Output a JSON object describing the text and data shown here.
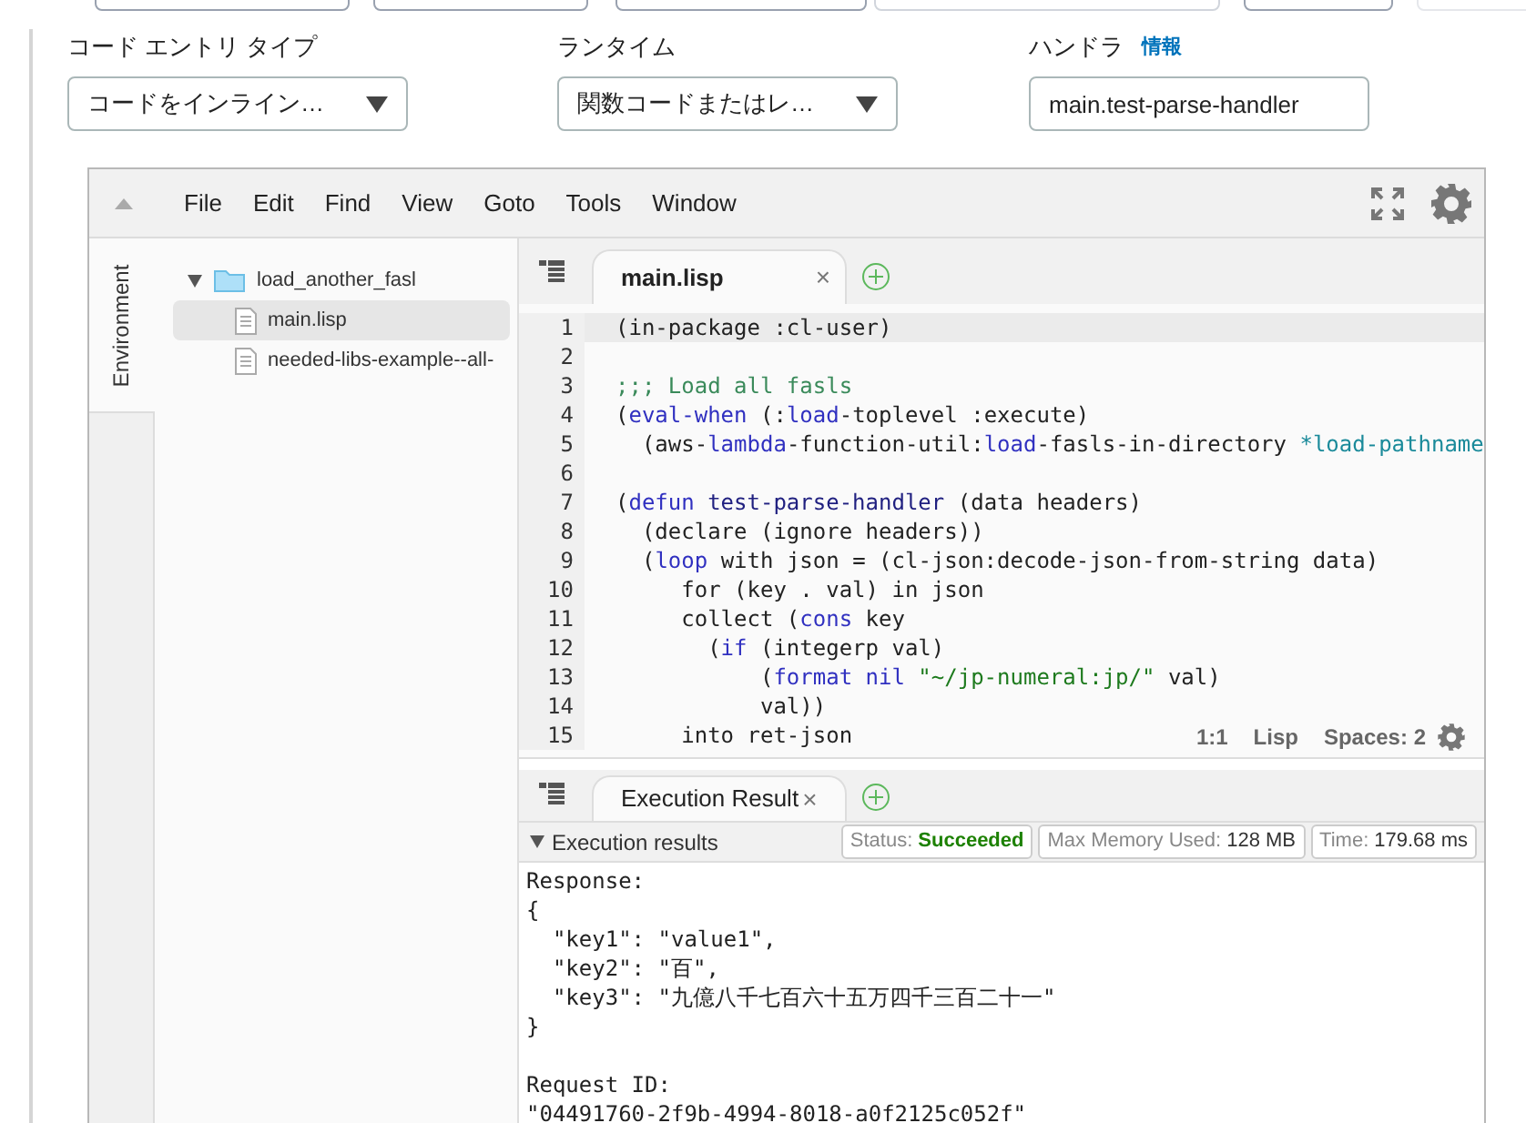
{
  "config": {
    "fields": [
      {
        "label": "コード エントリ タイプ",
        "kind": "select",
        "value": "コードをインライン…"
      },
      {
        "label": "ランタイム",
        "kind": "select",
        "value": "関数コードまたはレ…"
      },
      {
        "label": "ハンドラ",
        "info": "情報",
        "kind": "text",
        "value": "main.test-parse-handler"
      }
    ]
  },
  "ide": {
    "menu": [
      "File",
      "Edit",
      "Find",
      "View",
      "Goto",
      "Tools",
      "Window"
    ],
    "side_tab": "Environment",
    "tree": [
      {
        "label": "load_another_fasl",
        "kind": "folder",
        "expanded": true,
        "selected": false,
        "children": [
          {
            "label": "main.lisp",
            "kind": "file",
            "selected": true
          },
          {
            "label": "needed-libs-example--all-",
            "kind": "file",
            "selected": false
          }
        ]
      }
    ],
    "editor_tab": {
      "label": "main.lisp",
      "close": "×"
    },
    "code": [
      {
        "n": "1",
        "active": true,
        "seg": [
          {
            "kind": "plain",
            "text": "(in-package :cl-user)"
          }
        ]
      },
      {
        "n": "2",
        "active": false
      },
      {
        "n": "3",
        "active": false,
        "seg": [
          {
            "kind": "comment",
            "text": ";;; Load all fasls"
          }
        ]
      },
      {
        "n": "4",
        "active": false,
        "seg": [
          {
            "kind": "plain",
            "text": "("
          },
          {
            "kind": "keyword",
            "text": "eval-when"
          },
          {
            "kind": "plain",
            "text": " (:"
          },
          {
            "kind": "keyword",
            "text": "load"
          },
          {
            "kind": "plain",
            "text": "-toplevel :execute)"
          }
        ]
      },
      {
        "n": "5",
        "active": false,
        "seg": [
          {
            "kind": "plain",
            "text": "  (aws-"
          },
          {
            "kind": "keyword",
            "text": "lambda"
          },
          {
            "kind": "plain",
            "text": "-function-util:"
          },
          {
            "kind": "keyword",
            "text": "load"
          },
          {
            "kind": "plain",
            "text": "-fasls-in-directory "
          },
          {
            "kind": "variable",
            "text": "*load-pathname"
          }
        ]
      },
      {
        "n": "6",
        "active": false
      },
      {
        "n": "7",
        "active": false,
        "seg": [
          {
            "kind": "plain",
            "text": "("
          },
          {
            "kind": "keyword",
            "text": "defun"
          },
          {
            "kind": "definition",
            "text": " test-parse-handler"
          },
          {
            "kind": "plain",
            "text": " (data headers)"
          }
        ]
      },
      {
        "n": "8",
        "active": false,
        "seg": [
          {
            "kind": "plain",
            "text": "  (declare (ignore headers))"
          }
        ]
      },
      {
        "n": "9",
        "active": false,
        "seg": [
          {
            "kind": "plain",
            "text": "  ("
          },
          {
            "kind": "keyword",
            "text": "loop"
          },
          {
            "kind": "plain",
            "text": " with json = (cl-json:decode-json-from-string data)"
          }
        ]
      },
      {
        "n": "10",
        "active": false,
        "seg": [
          {
            "kind": "plain",
            "text": "     for (key . val) in json"
          }
        ]
      },
      {
        "n": "11",
        "active": false,
        "seg": [
          {
            "kind": "plain",
            "text": "     collect ("
          },
          {
            "kind": "keyword",
            "text": "cons"
          },
          {
            "kind": "plain",
            "text": " key"
          }
        ]
      },
      {
        "n": "12",
        "active": false,
        "seg": [
          {
            "kind": "plain",
            "text": "       ("
          },
          {
            "kind": "keyword",
            "text": "if"
          },
          {
            "kind": "plain",
            "text": " (integerp val)"
          }
        ]
      },
      {
        "n": "13",
        "active": false,
        "seg": [
          {
            "kind": "plain",
            "text": "           ("
          },
          {
            "kind": "keyword",
            "text": "format nil"
          },
          {
            "kind": "string",
            "text": " \"~/jp-numeral:jp/\""
          },
          {
            "kind": "plain",
            "text": " val)"
          }
        ]
      },
      {
        "n": "14",
        "active": false,
        "seg": [
          {
            "kind": "plain",
            "text": "           val))"
          }
        ]
      },
      {
        "n": "15",
        "active": false,
        "seg": [
          {
            "kind": "plain",
            "text": "     into ret-json"
          }
        ]
      }
    ],
    "status": {
      "position": "1:1",
      "mode": "Lisp",
      "indent": "Spaces: 2"
    },
    "result_tab": {
      "label": "Execution Result",
      "close": "×"
    },
    "results": {
      "title": "Execution results",
      "expanded": true,
      "badges": [
        {
          "label": "Status:",
          "value": "Succeeded",
          "kind": "success"
        },
        {
          "label": "Max Memory Used:",
          "value": "128 MB",
          "kind": "plain"
        },
        {
          "label": "Time:",
          "value": "179.68 ms",
          "kind": "plain"
        }
      ],
      "output": [
        [
          "Response:",
          "{",
          "  \"key1\": \"value1\",",
          "  \"key2\": \"百\",",
          "  \"key3\": \"九億八千七百六十五万四千三百二十一\"",
          "}"
        ],
        [
          "Request ID:",
          "\"04491760-2f9b-4994-8018-a0f2125c052f\""
        ]
      ]
    }
  }
}
